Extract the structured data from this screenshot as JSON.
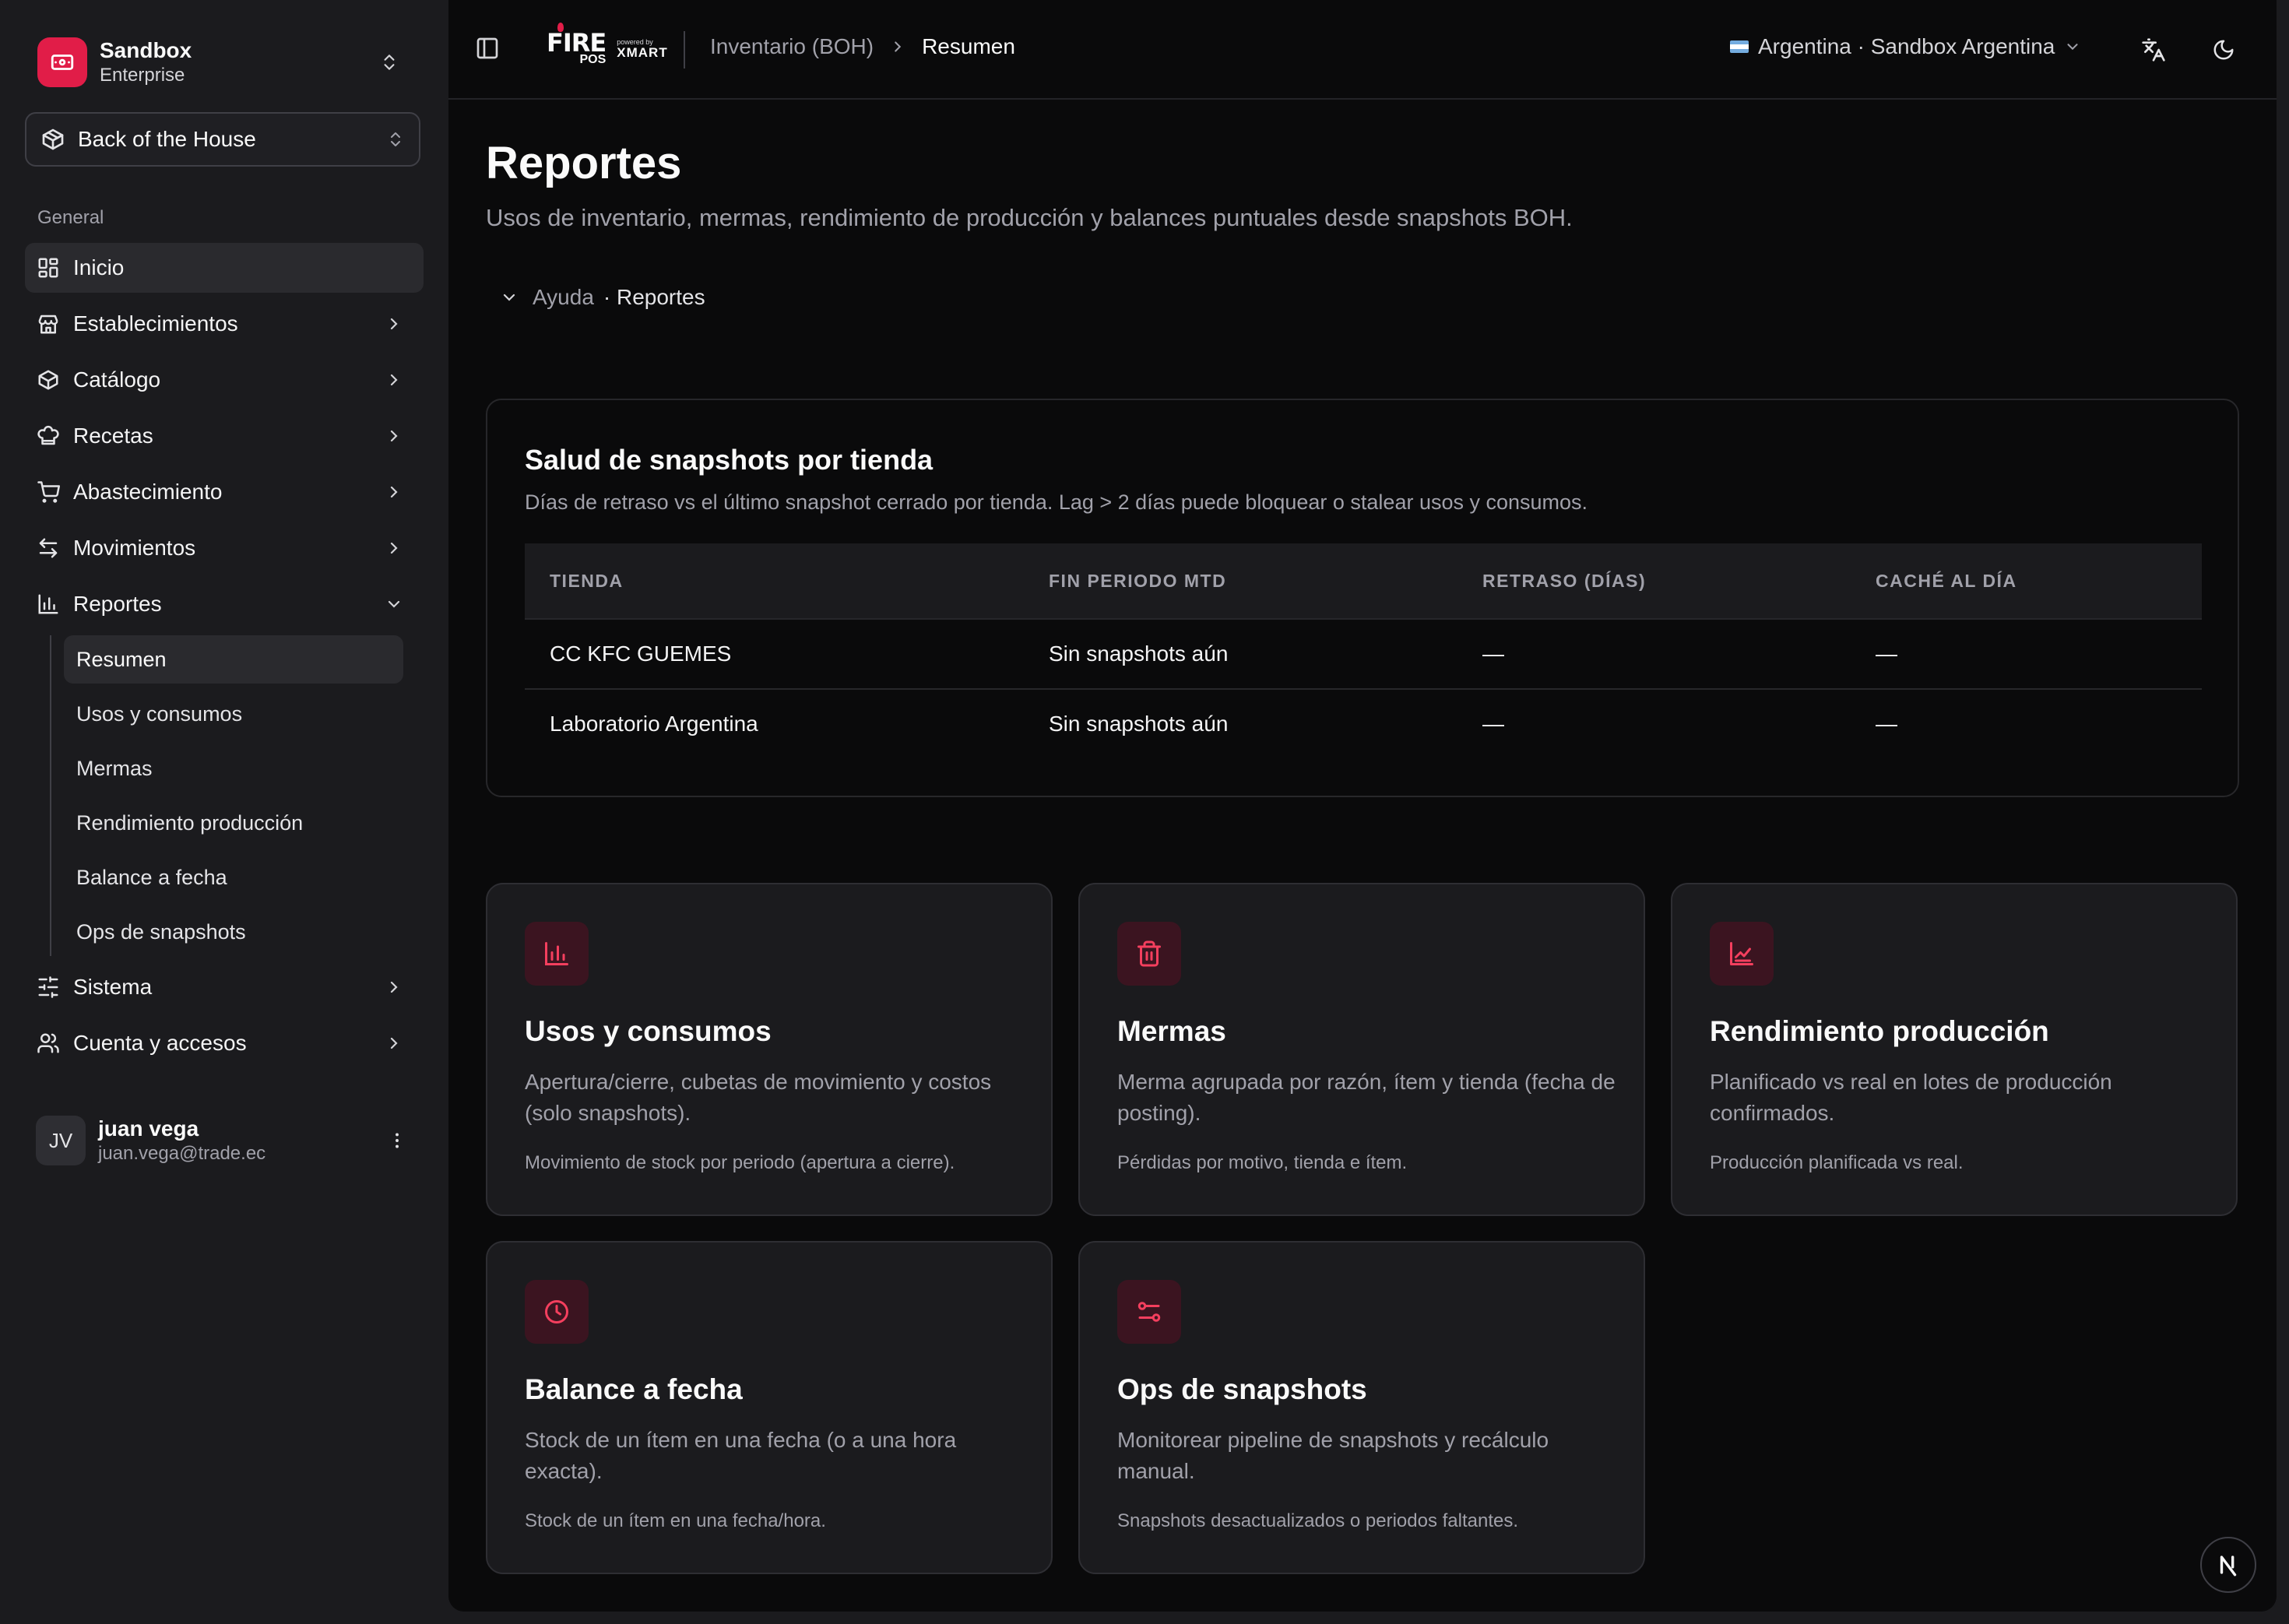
{
  "org": {
    "name": "Sandbox",
    "plan": "Enterprise"
  },
  "module": {
    "label": "Back of the House"
  },
  "sidebar": {
    "section_label": "General",
    "items": [
      {
        "label": "Inicio"
      },
      {
        "label": "Establecimientos"
      },
      {
        "label": "Catálogo"
      },
      {
        "label": "Recetas"
      },
      {
        "label": "Abastecimiento"
      },
      {
        "label": "Movimientos"
      },
      {
        "label": "Reportes"
      },
      {
        "label": "Sistema"
      },
      {
        "label": "Cuenta y accesos"
      }
    ],
    "reportes_sub": [
      {
        "label": "Resumen"
      },
      {
        "label": "Usos y consumos"
      },
      {
        "label": "Mermas"
      },
      {
        "label": "Rendimiento producción"
      },
      {
        "label": "Balance a fecha"
      },
      {
        "label": "Ops de snapshots"
      }
    ]
  },
  "user": {
    "initials": "JV",
    "name": "juan vega",
    "email": "juan.vega@trade.ec"
  },
  "topbar": {
    "brand_fire": "FIRE",
    "brand_pos": "POS",
    "brand_powered": "powered by",
    "brand_xmart": "XMART",
    "breadcrumb": [
      "Inventario (BOH)",
      "Resumen"
    ],
    "country": "Argentina · Sandbox Argentina",
    "icons": [
      "sidebar-toggle-icon",
      "translate-icon",
      "moon-icon"
    ]
  },
  "page": {
    "title": "Reportes",
    "subtitle": "Usos de inventario, mermas, rendimiento de producción y balances puntuales desde snapshots BOH.",
    "help": {
      "label": "Ayuda",
      "topic": "· Reportes"
    }
  },
  "health": {
    "title": "Salud de snapshots por tienda",
    "description": "Días de retraso vs el último snapshot cerrado por tienda. Lag > 2 días puede bloquear o stalear usos y consumos.",
    "columns": [
      "TIENDA",
      "FIN PERIODO MTD",
      "RETRASO (DÍAS)",
      "CACHÉ AL DÍA"
    ],
    "rows": [
      [
        "CC KFC GUEMES",
        "Sin snapshots aún",
        "—",
        "—"
      ],
      [
        "Laboratorio Argentina",
        "Sin snapshots aún",
        "—",
        "—"
      ]
    ]
  },
  "cards": [
    {
      "icon": "bar-chart-icon",
      "title": "Usos y consumos",
      "description": "Apertura/cierre, cubetas de movimiento y costos (solo snapshots).",
      "footer": "Movimiento de stock por periodo (apertura a cierre)."
    },
    {
      "icon": "trash-icon",
      "title": "Mermas",
      "description": "Merma agrupada por razón, ítem y tienda (fecha de posting).",
      "footer": "Pérdidas por motivo, tienda e ítem."
    },
    {
      "icon": "factory-icon",
      "title": "Rendimiento producción",
      "description": "Planificado vs real en lotes de producción confirmados.",
      "footer": "Producción planificada vs real."
    },
    {
      "icon": "clock-icon",
      "title": "Balance a fecha",
      "description": "Stock de un ítem en una fecha (o a una hora exacta).",
      "footer": "Stock de un ítem en una fecha/hora."
    },
    {
      "icon": "route-icon",
      "title": "Ops de snapshots",
      "description": "Monitorear pipeline de snapshots y recálculo manual.",
      "footer": "Snapshots desactualizados o periodos faltantes."
    }
  ],
  "colors": {
    "accent": "#e11d48",
    "background": "#0a0a0b",
    "sidebar": "#1b1b1e"
  }
}
